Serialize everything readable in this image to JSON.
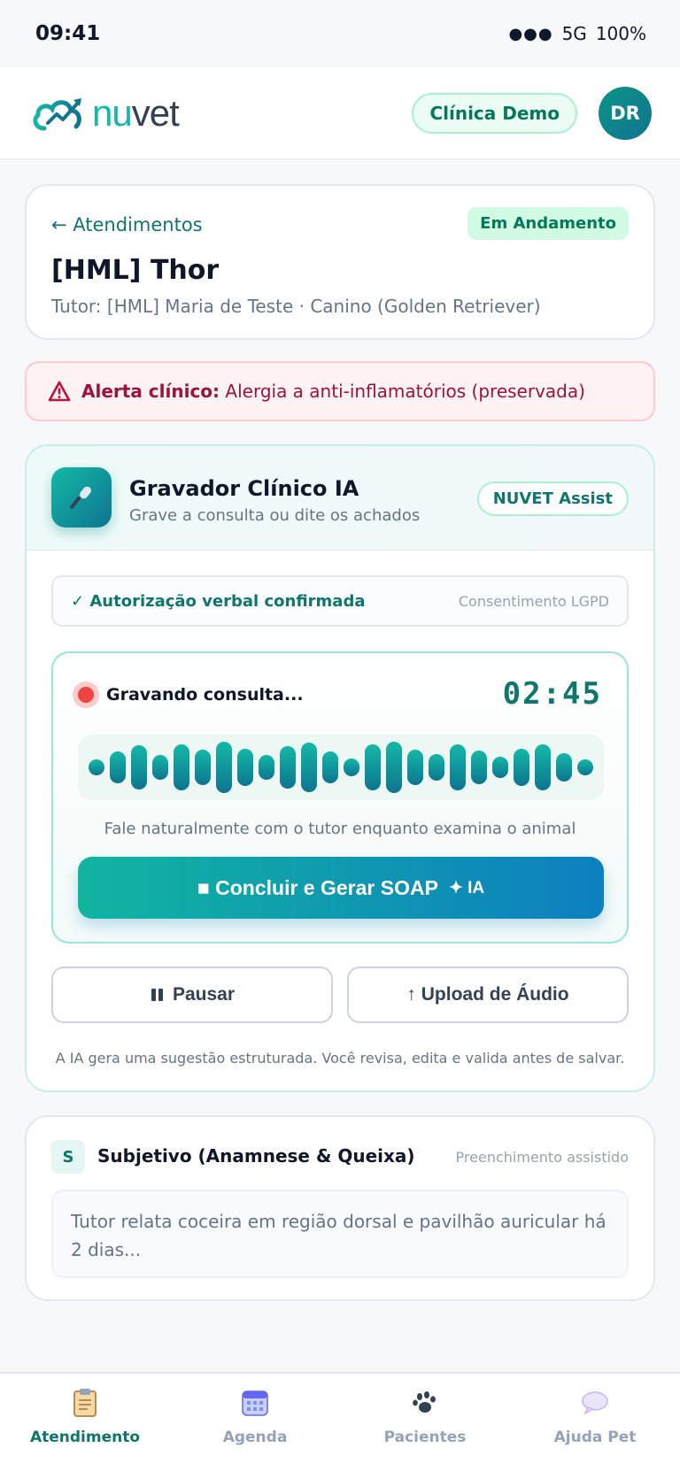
{
  "status_bar": {
    "time": "09:41",
    "network": "5G",
    "battery": "100%"
  },
  "header": {
    "logo_part1": "nu",
    "logo_part2": "vet",
    "clinic": "Clínica Demo",
    "avatar_initials": "DR"
  },
  "patient": {
    "back_label": "← Atendimentos",
    "status": "Em Andamento",
    "name": "[HML] Thor",
    "tutor_line": "Tutor: [HML] Maria de Teste · Canino (Golden Retriever)"
  },
  "alert": {
    "label": "Alerta clínico:",
    "text": "Alergia a anti-inflamatórios (preservada)"
  },
  "recorder": {
    "title": "Gravador Clínico IA",
    "subtitle": "Grave a consulta ou dite os achados",
    "badge": "NUVET Assist",
    "consent_ok": "✓ Autorização verbal confirmada",
    "consent_tag": "Consentimento LGPD",
    "recording_label": "Gravando consulta...",
    "timer": "02:45",
    "hint": "Fale naturalmente com o tutor enquanto examina o animal",
    "finish_button": "■ Concluir e Gerar SOAP",
    "finish_ia": "✦ IA",
    "pause_button": "Pausar",
    "upload_button": "↑ Upload de Áudio",
    "disclaimer": "A IA gera uma sugestão estruturada. Você revisa, edita e valida antes de salvar."
  },
  "soap": {
    "badge": "S",
    "title": "Subjetivo (Anamnese & Queixa)",
    "assist": "Preenchimento assistido",
    "text": "Tutor relata coceira em região dorsal e pavilhão auricular há 2 dias..."
  },
  "nav": {
    "items": [
      {
        "label": "Atendimento",
        "icon": "clipboard-icon",
        "active": true
      },
      {
        "label": "Agenda",
        "icon": "calendar-icon",
        "active": false
      },
      {
        "label": "Pacientes",
        "icon": "paw-icon",
        "active": false
      },
      {
        "label": "Ajuda Pet",
        "icon": "chat-bubble-icon",
        "active": false
      }
    ]
  },
  "colors": {
    "brand_teal": "#0f766e",
    "accent": "#14b8a6",
    "alert": "#9f1239",
    "recording": "#ef4444"
  }
}
